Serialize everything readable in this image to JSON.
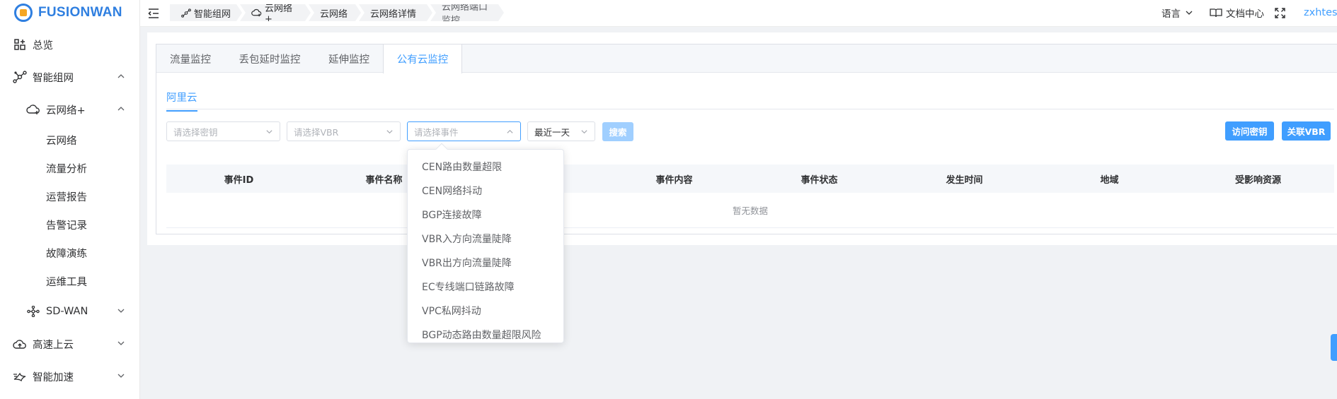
{
  "brand": {
    "name": "FUSIONWAN"
  },
  "sidebar": {
    "items": [
      {
        "label": "总览",
        "icon": "dashboard-icon"
      },
      {
        "label": "智能组网",
        "icon": "network-icon",
        "expanded": true
      },
      {
        "label": "云网络+",
        "icon": "cloud-network-icon",
        "expanded": true
      },
      {
        "label": "SD-WAN",
        "icon": "sdwan-icon",
        "expanded": false
      },
      {
        "label": "高速上云",
        "icon": "cloud-upload-icon",
        "expanded": false
      },
      {
        "label": "智能加速",
        "icon": "accelerate-icon",
        "expanded": false
      }
    ],
    "subitems": [
      "云网络",
      "流量分析",
      "运营报告",
      "告警记录",
      "故障演练",
      "运维工具"
    ]
  },
  "breadcrumb": [
    "智能组网",
    "云网络+",
    "云网络",
    "云网络详情",
    "云网络端口监控"
  ],
  "topbar": {
    "language": "语言",
    "docs": "文档中心",
    "user": "zxhtest"
  },
  "tabs": [
    "流量监控",
    "丢包延时监控",
    "延伸监控",
    "公有云监控"
  ],
  "active_tab": "公有云监控",
  "subtab": "阿里云",
  "filters": {
    "key_placeholder": "请选择密钥",
    "vbr_placeholder": "请选择VBR",
    "event_placeholder": "请选择事件",
    "time_value": "最近一天",
    "search_label": "搜索"
  },
  "actions": {
    "access_key_label": "访问密钥",
    "link_vbr_label": "关联VBR"
  },
  "table": {
    "columns": [
      "事件ID",
      "事件名称",
      "事件内容",
      "事件状态",
      "发生时间",
      "地域",
      "受影响资源"
    ],
    "empty_text": "暂无数据"
  },
  "event_options": [
    "CEN路由数量超限",
    "CEN网络抖动",
    "BGP连接故障",
    "VBR入方向流量陡降",
    "VBR出方向流量陡降",
    "EC专线端口链路故障",
    "VPC私网抖动",
    "BGP动态路由数量超限风险"
  ],
  "colors": {
    "accent": "#409eff",
    "brand": "#2f7fe0",
    "logo_accent": "#f5a623"
  }
}
